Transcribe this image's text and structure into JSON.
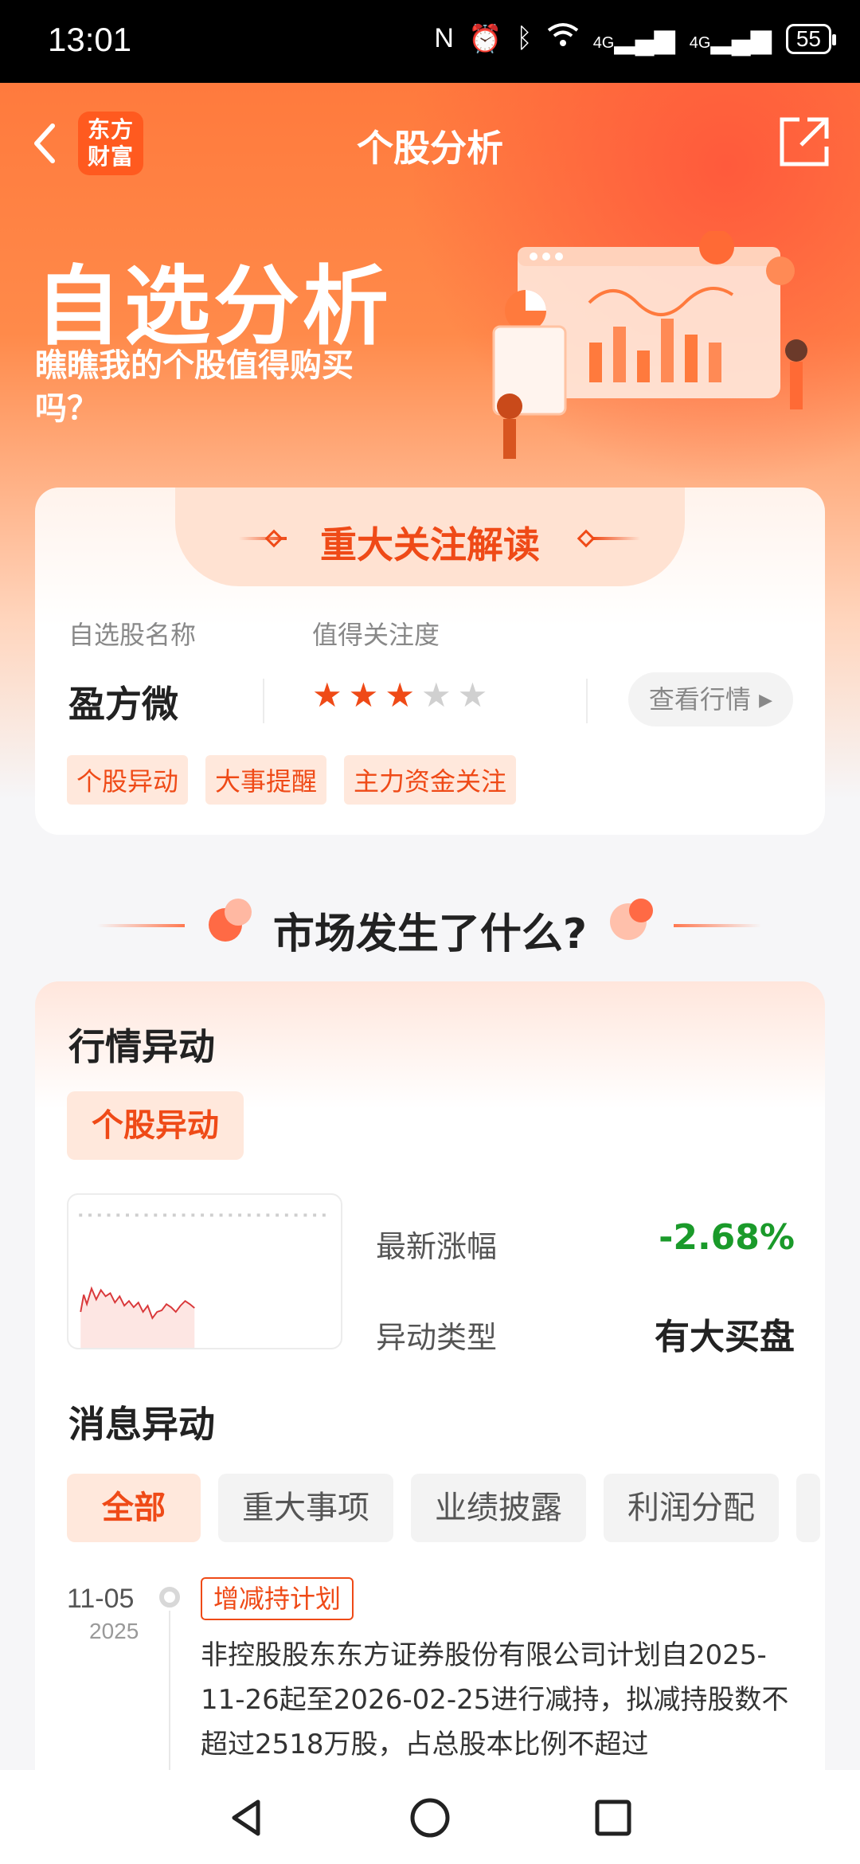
{
  "status_bar": {
    "time": "13:01",
    "signal1": "4G",
    "signal2": "4G",
    "battery": "55"
  },
  "header": {
    "logo_text": "东方财富",
    "title": "个股分析"
  },
  "hero": {
    "title": "自选分析",
    "subtitle": "瞧瞧我的个股值得购买吗？"
  },
  "focus": {
    "title": "重大关注解读",
    "name_label": "自选股名称",
    "attention_label": "值得关注度",
    "stock_name": "盈方微",
    "stars_filled": 3,
    "stars_total": 5,
    "view_quote": "查看行情",
    "tags": [
      "个股异动",
      "大事提醒",
      "主力资金关注"
    ]
  },
  "market": {
    "section_title": "市场发生了什么?",
    "card_title": "行情异动",
    "chip": "个股异动",
    "latest_change_label": "最新涨幅",
    "latest_change_value": "-2.68%",
    "anomaly_type_label": "异动类型",
    "anomaly_type_value": "有大买盘",
    "news_title": "消息异动",
    "filters": [
      "全部",
      "重大事项",
      "业绩披露",
      "利润分配"
    ],
    "timeline": [
      {
        "date": "11-05",
        "year": "2025",
        "tag": "增减持计划",
        "text": "非控股股东东方证券股份有限公司计划自2025-11-26起至2026-02-25进行减持，拟减持股数不超过2518万股，占总股本比例不超过"
      }
    ]
  },
  "colors": {
    "accent": "#ef4a17",
    "down": "#1a9a2a",
    "banner": "#ff7a3d"
  },
  "icons": [
    "back-icon",
    "share-icon",
    "star-icon",
    "caret-right-icon",
    "nav-back-icon",
    "nav-home-icon",
    "nav-recents-icon"
  ]
}
